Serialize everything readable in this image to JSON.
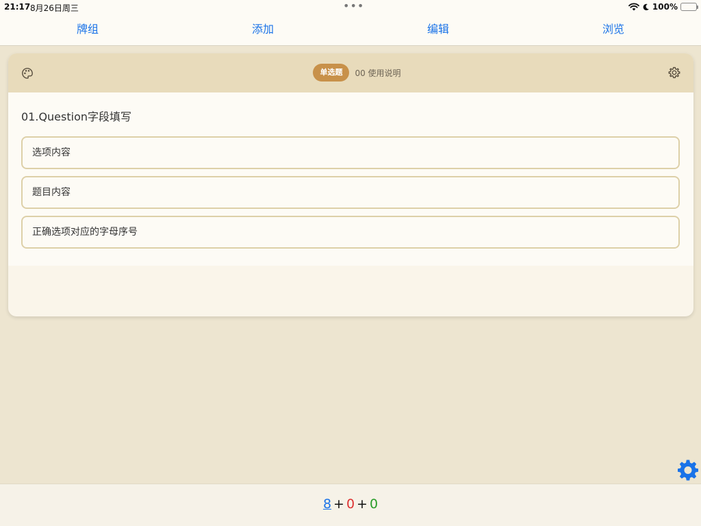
{
  "status_bar": {
    "time": "21:17",
    "date": "8月26日周三",
    "battery_text": "100%"
  },
  "nav": {
    "decks": "牌组",
    "add": "添加",
    "edit": "编辑",
    "browse": "浏览"
  },
  "card": {
    "note_type": "单选题",
    "deck_title": "00 使用说明",
    "question_title": "01.Question字段填写",
    "fields": [
      "选项内容",
      "题目内容",
      "正确选项对应的字母序号"
    ]
  },
  "counts": {
    "new": "8",
    "plus_1": "+",
    "learning": "0",
    "plus_2": "+",
    "review": "0"
  },
  "colors": {
    "nav_link": "#1a73e8",
    "header_bg": "#e8dbbb",
    "badge_bg": "#c8914a",
    "field_border": "#ddd0a8",
    "new_count": "#1a73e8",
    "learning_count": "#dd3333",
    "review_count": "#2a9d2a"
  },
  "icons": {
    "palette": "palette-icon",
    "settings": "gear-icon",
    "floating_settings": "gear-icon"
  }
}
